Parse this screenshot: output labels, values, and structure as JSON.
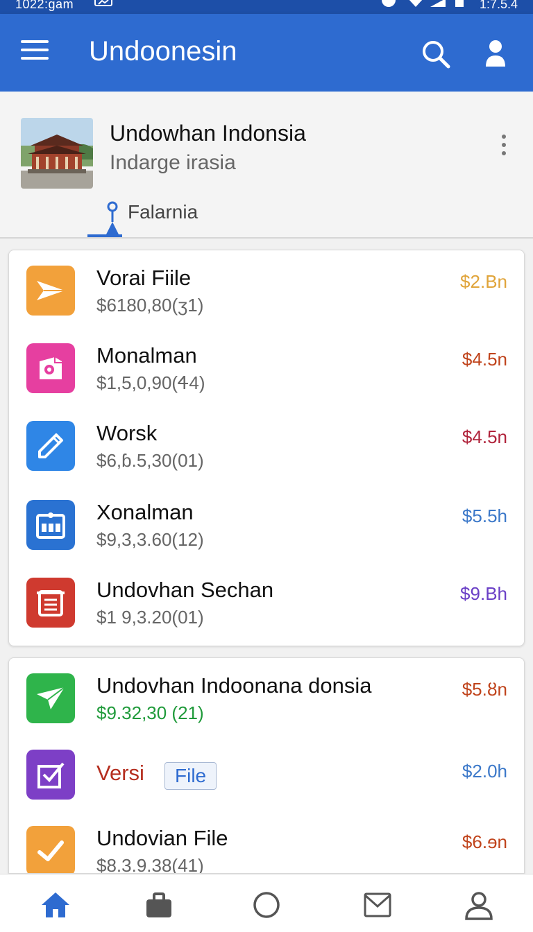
{
  "status_bar": {
    "time": "1022:gam",
    "right_time": "1:7.5.4"
  },
  "app_bar": {
    "title": "Undoonesin",
    "menu_icon": "hamburger-menu-icon",
    "search_icon": "search-icon",
    "account_icon": "person-icon"
  },
  "profile": {
    "name": "Undowhan Indonsia",
    "subtitle": "Indarge irasia",
    "location_tab": "Falarnia"
  },
  "list1": [
    {
      "name": "Vorai Fiile",
      "sub": "$6180,80(ʒ1)",
      "amount": "$2.Bn",
      "color": "#e0a43a",
      "icon": "paper-plane-icon",
      "bg": "#f2a13b"
    },
    {
      "name": "Monalman",
      "sub": "$1,5,0,90(Ꮞ4)",
      "amount": "$4.5n",
      "color": "#c0441c",
      "icon": "camera-icon",
      "bg": "#e63fa0"
    },
    {
      "name": "Worsk",
      "sub": "$6,ɓ.5,30(01)",
      "amount": "$4.5n",
      "color": "#b0233b",
      "icon": "pencil-icon",
      "bg": "#2f86e6"
    },
    {
      "name": "Xonalman",
      "sub": "$9,3,3.60(12)",
      "amount": "$5.5h",
      "color": "#3b78c9",
      "icon": "calendar-icon",
      "bg": "#2a72d2"
    },
    {
      "name": "Undovhan Sechan",
      "sub": "$1 9,3.20(01)",
      "amount": "$9.Bh",
      "color": "#6a3fc6",
      "icon": "document-icon",
      "bg": "#cf3a2f"
    }
  ],
  "list2": [
    {
      "name": "Undovhan Indoonana donsia",
      "sub": "$9.32,30 (21)",
      "amount": "$5.ȣn",
      "color": "#c0441c",
      "sub_color": "#1f9a3a",
      "icon": "paper-plane-icon",
      "bg": "#2fb44b"
    },
    {
      "name": "Versi",
      "tag": "File",
      "amount": "$2.0h",
      "color": "#3b78c9",
      "name_color": "#b52e1f",
      "icon": "edit-box-icon",
      "bg": "#7d3fc6"
    },
    {
      "name": "Undovian File",
      "sub": "$8.3.9.38(41)",
      "amount": "$6.ɘn",
      "color": "#c0441c",
      "icon": "checkmark-icon",
      "bg": "#f2a13b"
    }
  ],
  "bottom_nav": [
    {
      "icon": "home-icon"
    },
    {
      "icon": "briefcase-icon"
    },
    {
      "icon": "circle-icon"
    },
    {
      "icon": "mail-icon"
    },
    {
      "icon": "profile-icon"
    }
  ]
}
